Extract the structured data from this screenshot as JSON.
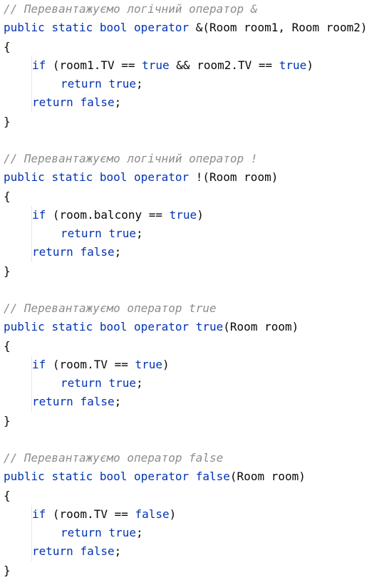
{
  "colors": {
    "keyword": "#0033b3",
    "comment": "#8c8c8c",
    "text": "#080808",
    "background": "#ffffff"
  },
  "code": {
    "b1": {
      "comment": "// Перевантажуємо логічний оператор &",
      "sig": [
        "public",
        "static",
        "bool",
        "operator",
        " &(Room room1, Room room2)"
      ],
      "open": "{",
      "if_kw": "if",
      "if_a": " (room1.TV == ",
      "true1": "true",
      "if_b": " && room2.TV == ",
      "true2": "true",
      "if_c": ")",
      "ret1_kw": "return",
      "ret1_val": "true",
      "ret2_kw": "return",
      "ret2_val": "false",
      "close": "}"
    },
    "b2": {
      "comment": "// Перевантажуємо логічний оператор !",
      "sig": [
        "public",
        "static",
        "bool",
        "operator",
        " !(Room room)"
      ],
      "open": "{",
      "if_kw": "if",
      "if_a": " (room.balcony == ",
      "true1": "true",
      "if_c": ")",
      "ret1_kw": "return",
      "ret1_val": "true",
      "ret2_kw": "return",
      "ret2_val": "false",
      "close": "}"
    },
    "b3": {
      "comment": "// Перевантажуємо оператор true",
      "sig": [
        "public",
        "static",
        "bool",
        "operator",
        "true",
        "(Room room)"
      ],
      "open": "{",
      "if_kw": "if",
      "if_a": " (room.TV == ",
      "true1": "true",
      "if_c": ")",
      "ret1_kw": "return",
      "ret1_val": "true",
      "ret2_kw": "return",
      "ret2_val": "false",
      "close": "}"
    },
    "b4": {
      "comment": "// Перевантажуємо оператор false",
      "sig": [
        "public",
        "static",
        "bool",
        "operator",
        "false",
        "(Room room)"
      ],
      "open": "{",
      "if_kw": "if",
      "if_a": " (room.TV == ",
      "false1": "false",
      "if_c": ")",
      "ret1_kw": "return",
      "ret1_val": "true",
      "ret2_kw": "return",
      "ret2_val": "false",
      "close": "}"
    }
  }
}
